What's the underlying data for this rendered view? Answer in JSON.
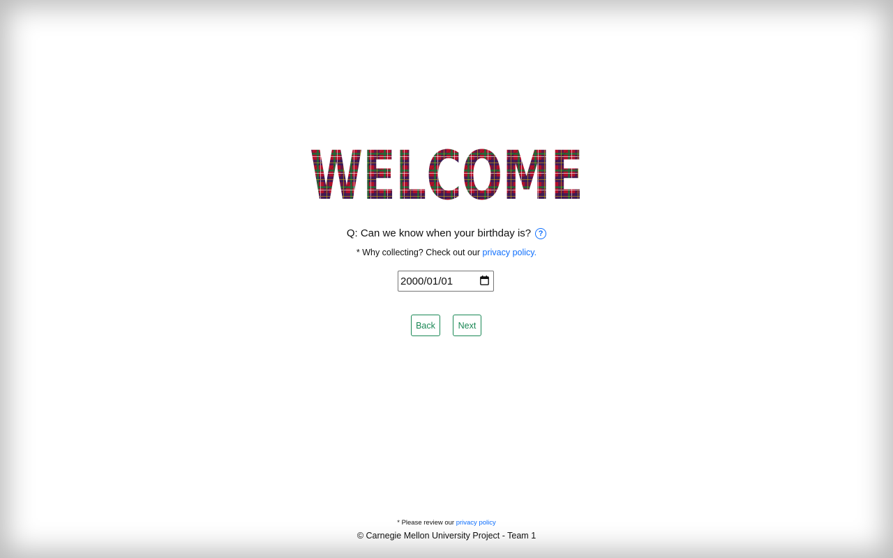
{
  "header": {
    "welcome_text": "WELCOME"
  },
  "question": {
    "text": "Q: Can we know when your birthday is?",
    "help_icon": "question-circle-icon",
    "why_prefix": "* Why collecting? Check out our ",
    "why_link": "privacy policy",
    "why_suffix": "."
  },
  "birthday_input": {
    "value": "2000/01/01",
    "icon": "calendar-icon"
  },
  "buttons": {
    "back_label": "Back",
    "next_label": "Next"
  },
  "footer": {
    "note_prefix": "* Please review our ",
    "note_link": "privacy policy",
    "copyright": "© Carnegie Mellon University Project - Team 1"
  },
  "colors": {
    "link": "#0d6efd",
    "button_accent": "#198754",
    "plaid_primary": "#c8102e",
    "plaid_secondary": "#1b2a6b"
  }
}
